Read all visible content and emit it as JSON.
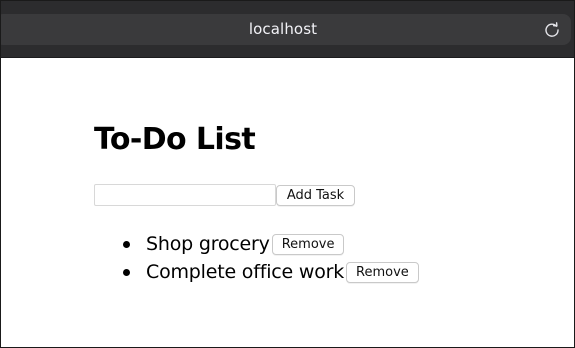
{
  "browser": {
    "url": "localhost",
    "reload_icon": "reload-icon"
  },
  "page": {
    "title": "To-Do List",
    "input": {
      "value": "",
      "placeholder": ""
    },
    "add_button_label": "Add Task",
    "tasks": [
      {
        "text": "Shop grocery",
        "remove_label": "Remove"
      },
      {
        "text": "Complete office work",
        "remove_label": "Remove"
      }
    ]
  }
}
